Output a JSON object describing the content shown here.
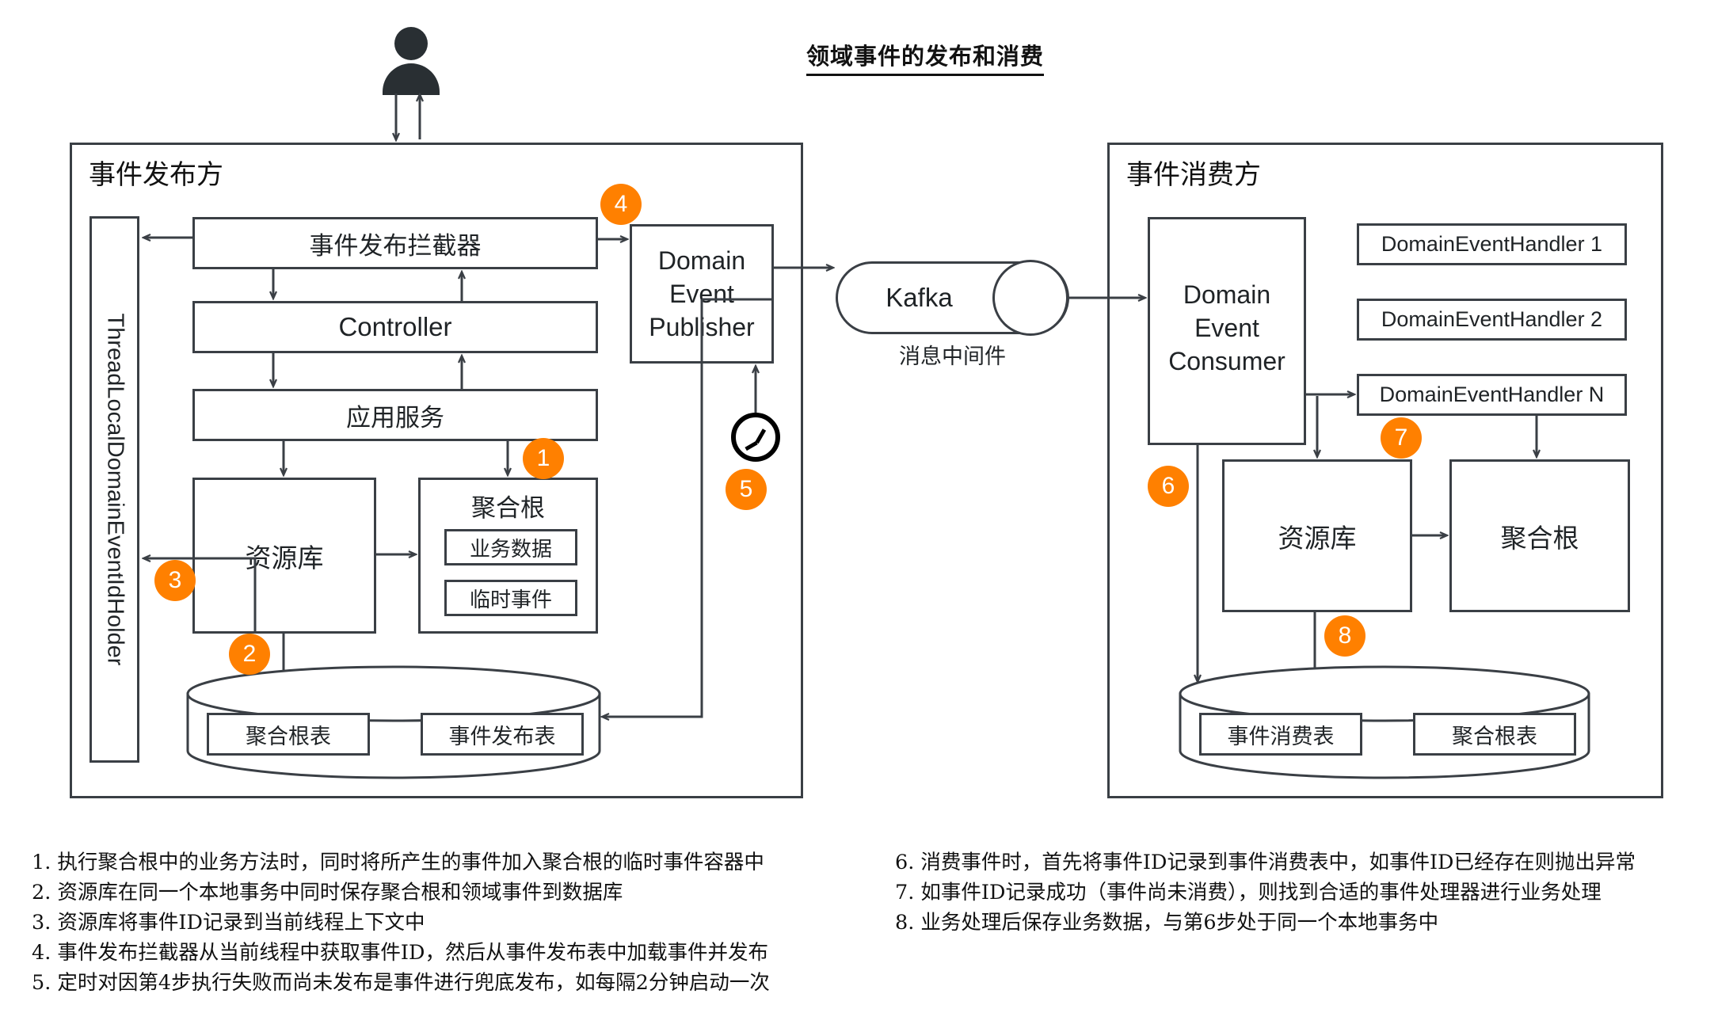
{
  "title": "领域事件的发布和消费",
  "actor": {
    "icon": "person-icon"
  },
  "publisher_panel": {
    "title": "事件发布方",
    "threadlocal_label": "ThreadLocalDomainEventIdHolder",
    "interceptor": "事件发布拦截器",
    "controller": "Controller",
    "app_service": "应用服务",
    "repository": "资源库",
    "aggregate_root": "聚合根",
    "aggregate_business_data": "业务数据",
    "aggregate_temp_events": "临时事件",
    "publisher": "Domain\nEvent\nPublisher",
    "publisher_lines": [
      "Domain",
      "Event",
      "Publisher"
    ],
    "db_tables": [
      "聚合根表",
      "事件发布表"
    ],
    "scheduler_icon": "clock-icon"
  },
  "middleware": {
    "name": "Kafka",
    "caption": "消息中间件"
  },
  "consumer_panel": {
    "title": "事件消费方",
    "consumer_lines": [
      "Domain",
      "Event",
      "Consumer"
    ],
    "handlers": [
      "DomainEventHandler 1",
      "DomainEventHandler 2",
      "DomainEventHandler N"
    ],
    "repository": "资源库",
    "aggregate_root": "聚合根",
    "db_tables": [
      "事件消费表",
      "聚合根表"
    ]
  },
  "badges": {
    "b1": "1",
    "b2": "2",
    "b3": "3",
    "b4": "4",
    "b5": "5",
    "b6": "6",
    "b7": "7",
    "b8": "8"
  },
  "legend_left": [
    "1. 执行聚合根中的业务方法时，同时将所产生的事件加入聚合根的临时事件容器中",
    "2. 资源库在同一个本地事务中同时保存聚合根和领域事件到数据库",
    "3. 资源库将事件ID记录到当前线程上下文中",
    "4. 事件发布拦截器从当前线程中获取事件ID，然后从事件发布表中加载事件并发布",
    "5. 定时对因第4步执行失败而尚未发布是事件进行兜底发布，如每隔2分钟启动一次"
  ],
  "legend_right": [
    "6. 消费事件时，首先将事件ID记录到事件消费表中，如事件ID已经存在则抛出异常",
    "7. 如事件ID记录成功（事件尚未消费），则找到合适的事件处理器进行业务处理",
    "8. 业务处理后保存业务数据，与第6步处于同一个本地事务中"
  ],
  "colors": {
    "accent": "#FF8000",
    "stroke": "#3a3f45",
    "actor": "#292F33"
  }
}
